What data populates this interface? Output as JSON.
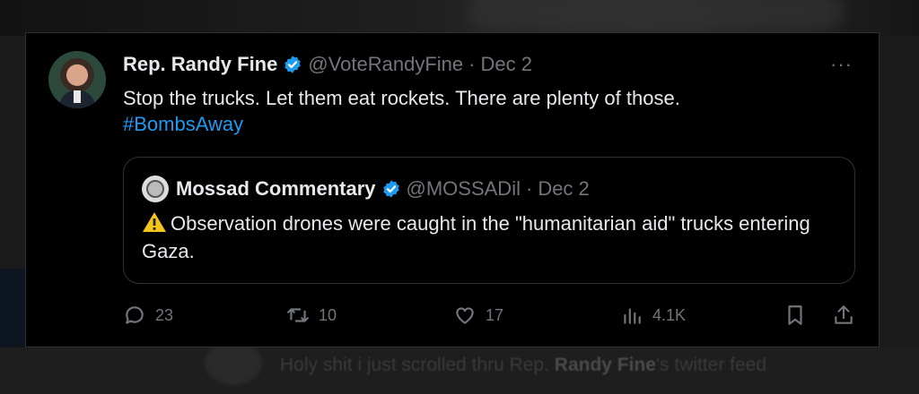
{
  "background": {
    "comment_prefix": "Holy shit i just scrolled thru Rep.",
    "comment_name": "Randy Fine",
    "comment_suffix": "'s twitter feed"
  },
  "tweet": {
    "author_name": "Rep. Randy Fine",
    "handle": "@VoteRandyFine",
    "separator": "·",
    "date": "Dec 2",
    "more_label": "···",
    "text": "Stop the trucks.  Let them eat rockets.  There are plenty of those.",
    "hashtag": "#BombsAway"
  },
  "quote": {
    "author_name": "Mossad Commentary",
    "handle": "@MOSSADil",
    "separator": "·",
    "date": "Dec 2",
    "text": "Observation drones were caught in the \"humanitarian aid\" trucks entering Gaza."
  },
  "actions": {
    "replies": "23",
    "reposts": "10",
    "likes": "17",
    "views": "4.1K"
  },
  "colors": {
    "accent": "#1d9bf0",
    "muted": "#71767b",
    "border": "#2f3336"
  }
}
